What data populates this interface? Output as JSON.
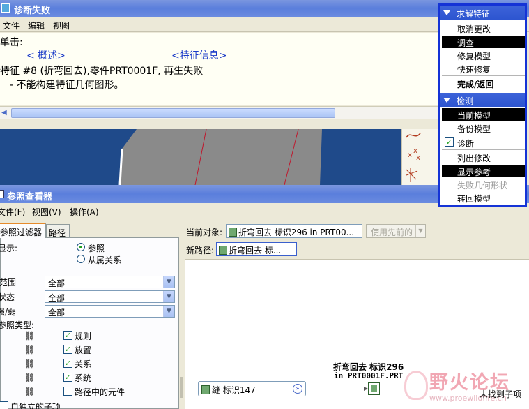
{
  "diagnose_window": {
    "title": "诊断失败",
    "menu": [
      "文件",
      "编辑",
      "视图"
    ],
    "line1": "单击:",
    "link_overview": "< 概述>",
    "link_feature_info": "<特征信息>",
    "line2": "特征 #8 (折弯回去),零件PRT0001F,  再生失败",
    "line3": "- 不能构建特征几何图形。"
  },
  "reference_viewer": {
    "title": "参照查看器",
    "menu": [
      "文件(F)",
      "视图(V)",
      "操作(A)"
    ],
    "tabs": {
      "filter": "参照过滤器",
      "path": "路径"
    },
    "display_label": "显示:",
    "radio_reference": "参照",
    "radio_dependency": "从属关系",
    "range_label": "范围",
    "range_value": "全部",
    "status_label": "状态",
    "status_value": "全部",
    "strength_label": "强/弱",
    "strength_value": "全部",
    "ref_types_label": "参照类型:",
    "ref_types": [
      {
        "label": "规则",
        "checked": true
      },
      {
        "label": "放置",
        "checked": true
      },
      {
        "label": "关系",
        "checked": true
      },
      {
        "label": "系统",
        "checked": true
      },
      {
        "label": "路径中的元件",
        "checked": false
      }
    ],
    "independent_children": "自独立的子项",
    "current_object_label": "当前对象:",
    "current_object_value": "折弯回去 标识296 in PRT00...",
    "use_previous_label": "使用先前的",
    "new_path_label": "新路径:",
    "new_path_value": "折弯回去 标...",
    "node_seam": "缝 标识147",
    "node_target_line1": "折弯回去 标识296",
    "node_target_line2": "in PRT0001F.PRT",
    "not_found": "未找到子项"
  },
  "watermark": {
    "logo": "野火论坛",
    "url": "www.proewildfire.cn"
  },
  "menu_manager": {
    "section1_title": "求解特征",
    "section1_items": [
      {
        "label": "取消更改",
        "selected": false,
        "dim": false,
        "bold": false
      },
      {
        "label": "调查",
        "selected": true,
        "dim": false,
        "bold": false
      },
      {
        "label": "修复模型",
        "selected": false,
        "dim": false,
        "bold": false
      },
      {
        "label": "快速修复",
        "selected": false,
        "dim": false,
        "bold": false
      },
      {
        "label": "完成/返回",
        "selected": false,
        "dim": false,
        "bold": true
      }
    ],
    "section2_title": "检测",
    "section2_items": [
      {
        "label": "当前模型",
        "selected": true,
        "dim": false,
        "bold": false
      },
      {
        "label": "备份模型",
        "selected": false,
        "dim": false,
        "bold": false
      },
      {
        "label": "诊断",
        "selected": false,
        "dim": false,
        "bold": false,
        "checkbox": true
      },
      {
        "label": "列出修改",
        "selected": false,
        "dim": false,
        "bold": false
      },
      {
        "label": "显示参考",
        "selected": true,
        "dim": false,
        "bold": false
      },
      {
        "label": "失败几何形状",
        "selected": false,
        "dim": true,
        "bold": false
      },
      {
        "label": "转回模型",
        "selected": false,
        "dim": false,
        "bold": false
      }
    ]
  }
}
